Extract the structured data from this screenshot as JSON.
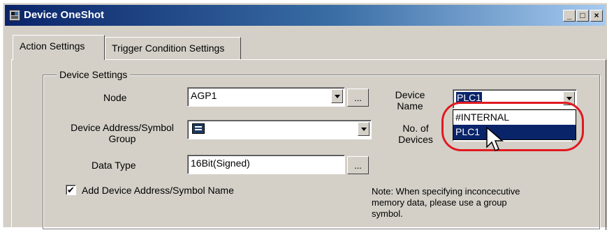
{
  "window": {
    "title": "Device OneShot",
    "controls": {
      "minimize": "_",
      "maximize": "□",
      "close": "×"
    }
  },
  "tabs": [
    {
      "label": "Action Settings",
      "active": true
    },
    {
      "label": "Trigger Condition Settings",
      "active": false
    }
  ],
  "device_settings": {
    "group_label": "Device Settings",
    "node": {
      "label": "Node",
      "value": "AGP1",
      "browse_label": "..."
    },
    "device_address": {
      "label_line1": "Device Address/Symbol",
      "label_line2": "Group",
      "value": ""
    },
    "data_type": {
      "label": "Data Type",
      "value": "16Bit(Signed)",
      "browse_label": "..."
    },
    "add_symbol": {
      "label": "Add Device Address/Symbol Name",
      "checked": true,
      "mark": "✔"
    },
    "device_name": {
      "label_line1": "Device",
      "label_line2": "Name",
      "value": "PLC1",
      "options": [
        "#INTERNAL",
        "PLC1"
      ],
      "selected_index": 1
    },
    "no_of_devices": {
      "label_line1": "No. of",
      "label_line2": "Devices"
    },
    "note": {
      "line1": "Note: When specifying inconcecutive",
      "line2": "memory data, please use a group",
      "line3": "symbol."
    }
  },
  "colors": {
    "title_bar_start": "#0a246a",
    "title_bar_end": "#a6caf0",
    "selection": "#0a246a",
    "highlight_ring": "#e0191f",
    "dialog_face": "#d4d0c8"
  }
}
